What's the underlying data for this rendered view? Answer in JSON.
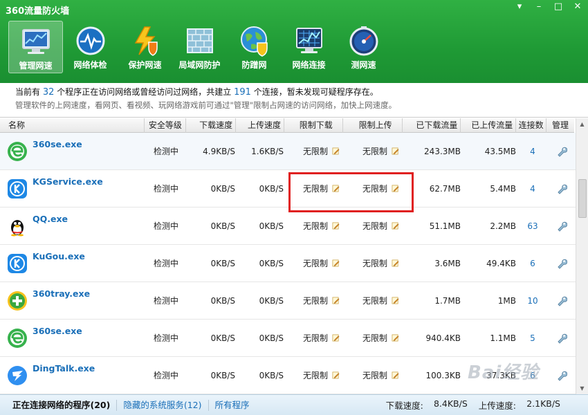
{
  "window": {
    "title": "360流量防火墙",
    "controls": [
      "▾",
      "–",
      "□",
      "✕"
    ]
  },
  "toolbar": [
    {
      "label": "管理网速",
      "icon": "monitor-chart-icon",
      "active": true
    },
    {
      "label": "网络体检",
      "icon": "heartbeat-globe-icon"
    },
    {
      "label": "保护网速",
      "icon": "lightning-shield-icon"
    },
    {
      "label": "局域网防护",
      "icon": "brick-wall-icon"
    },
    {
      "label": "防蹭网",
      "icon": "globe-shield-icon"
    },
    {
      "label": "网络连接",
      "icon": "network-monitor-icon"
    },
    {
      "label": "测网速",
      "icon": "speedometer-icon"
    }
  ],
  "info": {
    "line1_prefix": "当前有",
    "programs": "32",
    "line1_mid": "个程序正在访问网络或曾经访问过网络，共建立",
    "connections": "191",
    "line1_suffix": "个连接，暂未发现可疑程序存在。",
    "line2": "管理软件的上网速度，看网页、看视频、玩网络游戏前可通过\"管理\"限制占网速的访问网络，加快上网速度。"
  },
  "columns": {
    "name": "名称",
    "security": "安全等级",
    "download_speed": "下载速度",
    "upload_speed": "上传速度",
    "limit_download": "限制下载",
    "limit_upload": "限制上传",
    "downloaded": "已下载流量",
    "uploaded": "已上传流量",
    "connections": "连接数",
    "manage": "管理"
  },
  "rows": [
    {
      "name": "360se.exe",
      "icon": "360se-icon",
      "security": "检测中",
      "down": "4.9KB/S",
      "up": "1.6KB/S",
      "limit_down": "无限制",
      "limit_up": "无限制",
      "downloaded": "243.3MB",
      "uploaded": "43.5MB",
      "conn": "4"
    },
    {
      "name": "KGService.exe",
      "icon": "kugou-icon",
      "security": "检测中",
      "down": "0KB/S",
      "up": "0KB/S",
      "limit_down": "无限制",
      "limit_up": "无限制",
      "downloaded": "62.7MB",
      "uploaded": "5.4MB",
      "conn": "4"
    },
    {
      "name": "QQ.exe",
      "icon": "qq-penguin-icon",
      "security": "检测中",
      "down": "0KB/S",
      "up": "0KB/S",
      "limit_down": "无限制",
      "limit_up": "无限制",
      "downloaded": "51.1MB",
      "uploaded": "2.2MB",
      "conn": "63"
    },
    {
      "name": "KuGou.exe",
      "icon": "kugou-icon",
      "security": "检测中",
      "down": "0KB/S",
      "up": "0KB/S",
      "limit_down": "无限制",
      "limit_up": "无限制",
      "downloaded": "3.6MB",
      "uploaded": "49.4KB",
      "conn": "6"
    },
    {
      "name": "360tray.exe",
      "icon": "360-safe-icon",
      "security": "检测中",
      "down": "0KB/S",
      "up": "0KB/S",
      "limit_down": "无限制",
      "limit_up": "无限制",
      "downloaded": "1.7MB",
      "uploaded": "1MB",
      "conn": "10"
    },
    {
      "name": "360se.exe",
      "icon": "360se-icon",
      "security": "检测中",
      "down": "0KB/S",
      "up": "0KB/S",
      "limit_down": "无限制",
      "limit_up": "无限制",
      "downloaded": "940.4KB",
      "uploaded": "1.1MB",
      "conn": "5"
    },
    {
      "name": "DingTalk.exe",
      "icon": "dingtalk-icon",
      "security": "检测中",
      "down": "0KB/S",
      "up": "0KB/S",
      "limit_down": "无限制",
      "limit_up": "无限制",
      "downloaded": "100.3KB",
      "uploaded": "37.3KB",
      "conn": "6"
    }
  ],
  "status": {
    "tab_active": "正在连接网络的程序(20)",
    "tab_hidden": "隐藏的系统服务(12)",
    "tab_all": "所有程序",
    "down_label": "下载速度:",
    "down_value": "8.4KB/S",
    "up_label": "上传速度:",
    "up_value": "2.1KB/S"
  },
  "watermark": "Bai经验",
  "colors": {
    "title_green": "#1f9a35",
    "link_blue": "#1a6fb8",
    "highlight_red": "#e02020"
  }
}
